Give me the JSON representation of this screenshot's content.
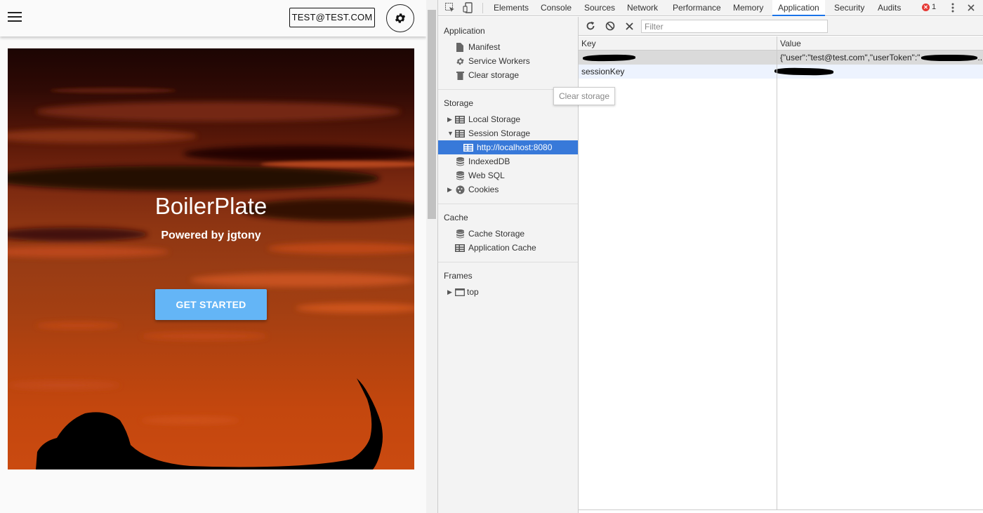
{
  "app": {
    "user_label": "TEST@TEST.COM",
    "hero": {
      "title": "BoilerPlate",
      "subtitle": "Powered by jgtony",
      "cta_label": "GET STARTED"
    }
  },
  "devtools": {
    "tabs": [
      "Elements",
      "Console",
      "Sources",
      "Network",
      "Performance",
      "Memory",
      "Application",
      "Security",
      "Audits"
    ],
    "active_tab": "Application",
    "error_count": "1",
    "sidebar": {
      "application": {
        "heading": "Application",
        "items": [
          "Manifest",
          "Service Workers",
          "Clear storage"
        ]
      },
      "storage": {
        "heading": "Storage",
        "items": [
          "Local Storage",
          "Session Storage",
          "http://localhost:8080",
          "IndexedDB",
          "Web SQL",
          "Cookies"
        ]
      },
      "cache": {
        "heading": "Cache",
        "items": [
          "Cache Storage",
          "Application Cache"
        ]
      },
      "frames": {
        "heading": "Frames",
        "items": [
          "top"
        ]
      },
      "selected": "http://localhost:8080"
    },
    "tooltip": "Clear storage",
    "filter_placeholder": "Filter",
    "grid": {
      "columns": [
        "Key",
        "Value"
      ],
      "rows": [
        {
          "key": "",
          "value": "{\"user\":\"test@test.com\",\"userToken\":\""
        },
        {
          "key": "sessionKey",
          "value": ""
        }
      ]
    },
    "accent_color": "#3879d9"
  }
}
